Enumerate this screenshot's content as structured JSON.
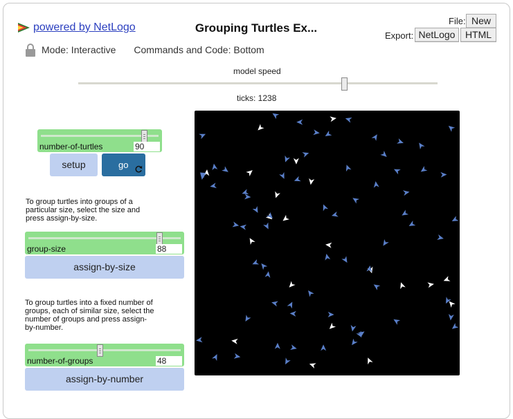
{
  "header": {
    "logo_link": "powered by NetLogo",
    "title": "Grouping Turtles Ex...",
    "file_label": "File:",
    "new_button": "New",
    "export_label": "Export:",
    "export_netlogo": "NetLogo",
    "export_html": "HTML"
  },
  "mode_bar": {
    "mode": "Mode: Interactive",
    "commands": "Commands and Code: Bottom"
  },
  "speed": {
    "label": "model speed",
    "value_fraction": 0.74
  },
  "ticks_text": "ticks: 1238",
  "widgets": {
    "number_of_turtles": {
      "label": "number-of-turtles",
      "value": "90"
    },
    "setup_label": "setup",
    "go_label": "go",
    "note1": "To group turtles into groups of a particular size, select the size and press assign-by-size.",
    "group_size": {
      "label": "group-size",
      "value": "88"
    },
    "assign_by_size_label": "assign-by-size",
    "note2": "To group turtles into a fixed number of groups, each of similar size, select the number of groups and press assign-by-number.",
    "number_of_groups": {
      "label": "number-of-groups",
      "value": "48"
    },
    "assign_by_number_label": "assign-by-number"
  },
  "colors": {
    "slider_green": "#8fdf8c",
    "button_blue": "#bfd0f0",
    "go_button": "#2a6ea0",
    "world_background": "#000000",
    "turtle_blue": "#5a7fc8",
    "turtle_white": "#ffffff",
    "link_blue": "#2b3fbf"
  },
  "icons": [
    "netlogo-logo-icon",
    "lock-icon",
    "forever-loop-icon"
  ]
}
